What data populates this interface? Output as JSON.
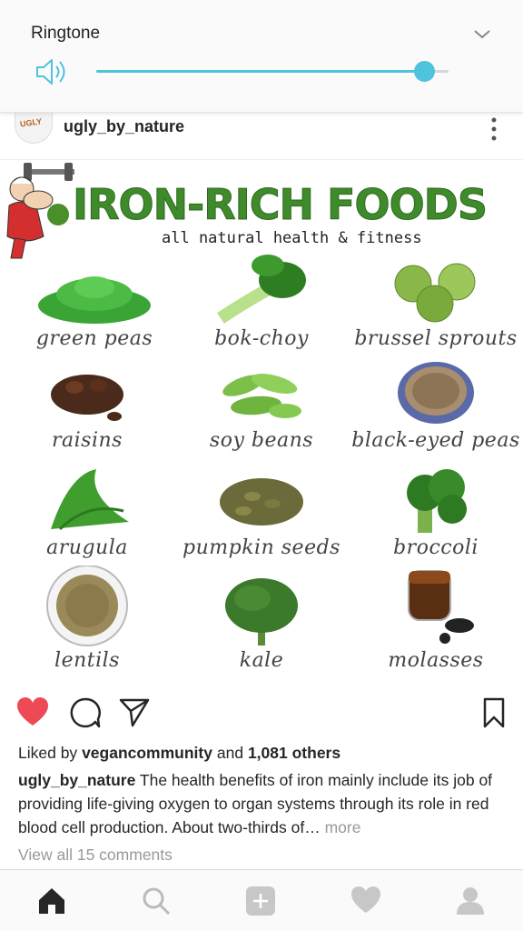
{
  "volume_panel": {
    "title": "Ringtone",
    "level": 0.93,
    "accent_color": "#4fc3dc",
    "icons": {
      "speaker": "speaker-icon",
      "collapse": "chevron-down-icon"
    }
  },
  "post": {
    "username": "ugly_by_nature",
    "avatar_text": "UGLY",
    "image": {
      "title": "IRON-RICH FOODS",
      "subtitle": "all natural health & fitness",
      "foods": [
        "green peas",
        "bok-choy",
        "brussel sprouts",
        "raisins",
        "soy beans",
        "black-eyed peas",
        "arugula",
        "pumpkin seeds",
        "broccoli",
        "lentils",
        "kale",
        "molasses"
      ]
    },
    "liked": true,
    "likes": {
      "prefix": "Liked by",
      "user": "vegancommunity",
      "and": "and",
      "count": "1,081 others"
    },
    "caption": {
      "user": "ugly_by_nature",
      "text": " The health benefits of iron mainly include its job of providing life-giving oxygen to organ systems through its role in red blood cell production. About two-thirds of…",
      "more": " more"
    },
    "view_comments": "View all 15 comments"
  },
  "nav": {
    "items": [
      "home-icon",
      "search-icon",
      "add-icon",
      "heart-icon",
      "profile-icon"
    ]
  }
}
